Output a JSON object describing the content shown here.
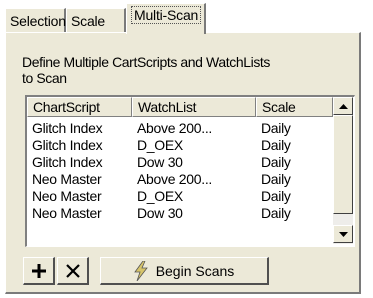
{
  "tabs": [
    {
      "label": "Selection"
    },
    {
      "label": "Scale"
    },
    {
      "label": "Multi-Scan"
    }
  ],
  "active_tab": "Multi-Scan",
  "description": "Define Multiple CartScripts and WatchLists to Scan",
  "table": {
    "columns": [
      "ChartScript",
      "WatchList",
      "Scale"
    ],
    "rows": [
      [
        "Glitch Index",
        "Above 200...",
        "Daily"
      ],
      [
        "Glitch Index",
        "D_OEX",
        "Daily"
      ],
      [
        "Glitch Index",
        "Dow 30",
        "Daily"
      ],
      [
        "Neo Master",
        "Above 200...",
        "Daily"
      ],
      [
        "Neo Master",
        "D_OEX",
        "Daily"
      ],
      [
        "Neo Master",
        "Dow 30",
        "Daily"
      ]
    ]
  },
  "buttons": {
    "add_icon": "plus-icon",
    "remove_icon": "x-icon",
    "begin_icon": "lightning-icon",
    "begin_label": "Begin Scans"
  },
  "colors": {
    "panel": "#ece9d8",
    "icon_accent": "#d6c46a"
  }
}
